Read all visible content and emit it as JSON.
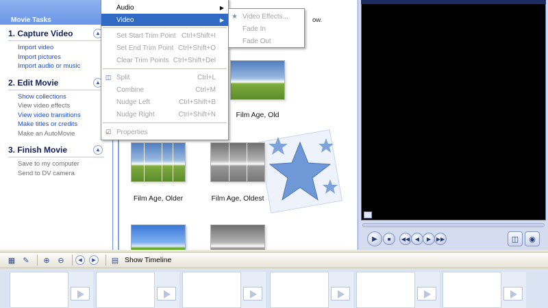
{
  "task_pane": {
    "header": "Movie Tasks",
    "sections": [
      {
        "title": "1. Capture Video",
        "links": [
          "Import video",
          "Import pictures",
          "Import audio or music"
        ]
      },
      {
        "title": "2. Edit Movie",
        "links": [
          "Show collections",
          "View video effects",
          "View video transitions",
          "Make titles or credits",
          "Make an AutoMovie"
        ]
      },
      {
        "title": "3. Finish Movie",
        "links": [
          "Save to my computer",
          "Send to DV camera"
        ]
      }
    ]
  },
  "collection": {
    "hint_fragment": "ow.",
    "effects": [
      {
        "label": "Film Age, Old",
        "style": "old"
      },
      {
        "label": "Film Age, Older",
        "style": "old"
      },
      {
        "label": "Film Age, Oldest",
        "style": "gray"
      }
    ]
  },
  "clip_menu": {
    "items": [
      {
        "label": "Audio",
        "shortcut": "",
        "submenu": true,
        "disabled": false
      },
      {
        "label": "Video",
        "shortcut": "",
        "submenu": true,
        "disabled": false,
        "selected": true
      },
      {
        "label": "Set Start Trim Point",
        "shortcut": "Ctrl+Shift+I",
        "disabled": true
      },
      {
        "label": "Set End Trim Point",
        "shortcut": "Ctrl+Shift+O",
        "disabled": true
      },
      {
        "label": "Clear Trim Points",
        "shortcut": "Ctrl+Shift+Del",
        "disabled": true
      },
      {
        "label": "Split",
        "shortcut": "Ctrl+L",
        "disabled": true,
        "icon": "split-icon"
      },
      {
        "label": "Combine",
        "shortcut": "Ctrl+M",
        "disabled": true
      },
      {
        "label": "Nudge Left",
        "shortcut": "Ctrl+Shift+B",
        "disabled": true
      },
      {
        "label": "Nudge Right",
        "shortcut": "Ctrl+Shift+N",
        "disabled": true
      },
      {
        "label": "Properties",
        "shortcut": "",
        "disabled": true,
        "icon": "properties-icon"
      }
    ]
  },
  "video_submenu": {
    "items": [
      "Video Effects...",
      "Fade In",
      "Fade Out"
    ]
  },
  "storyboard": {
    "show_timeline_label": "Show Timeline"
  },
  "colors": {
    "menu_highlight": "#316ac5",
    "link": "#1c4dcc",
    "task_header": "#6b95e8"
  }
}
